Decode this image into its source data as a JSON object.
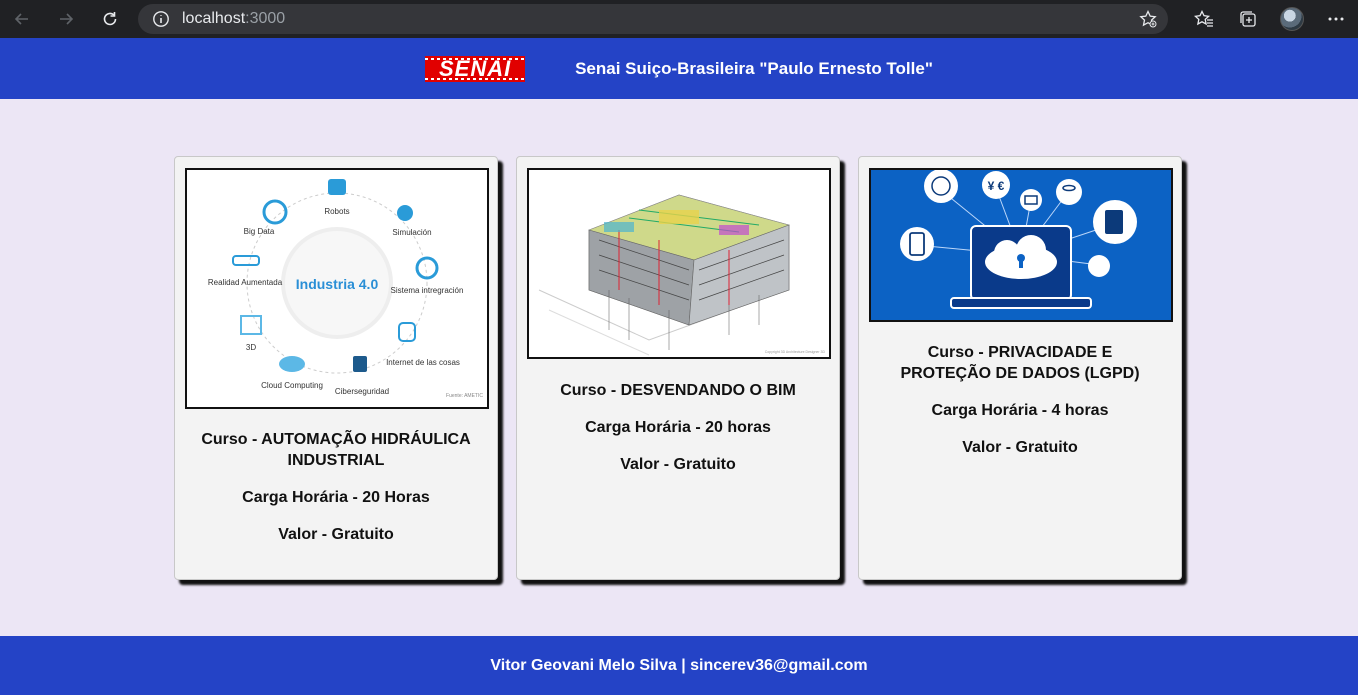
{
  "browser": {
    "url_host": "localhost",
    "url_port": ":3000"
  },
  "header": {
    "logo_text": "SENAI",
    "title": "Senai Suiço-Brasileira \"Paulo Ernesto Tolle\""
  },
  "cards": [
    {
      "title": "Curso - AUTOMAÇÃO HIDRÁULICA INDUSTRIAL",
      "hours": "Carga Horária - 20 Horas",
      "price": "Valor - Gratuito",
      "image": {
        "center": "Industria 4.0",
        "labels": [
          "Robots",
          "Simulación",
          "Sistema intregración",
          "Internet de las cosas",
          "Ciberseguridad",
          "Cloud Computing",
          "3D",
          "Realidad Aumentada",
          "Big Data"
        ],
        "source": "Fuente: AMETIC"
      }
    },
    {
      "title": "Curso - DESVENDANDO O BIM",
      "hours": "Carga Horária - 20 horas",
      "price": "Valor - Gratuito",
      "image": {
        "caption": "Copyright 3D Architecture Designer 3D"
      }
    },
    {
      "title": "Curso - PRIVACIDADE E PROTEÇÃO DE DADOS (LGPD)",
      "hours": "Carga Horária - 4 horas",
      "price": "Valor - Gratuito",
      "image": {
        "symbols": "¥ €"
      }
    }
  ],
  "footer": {
    "text": "Vitor Geovani Melo Silva | sincerev36@gmail.com"
  },
  "colors": {
    "brand_blue": "#2443c6",
    "page_bg": "#ece6f5",
    "senai_red": "#e10000"
  }
}
